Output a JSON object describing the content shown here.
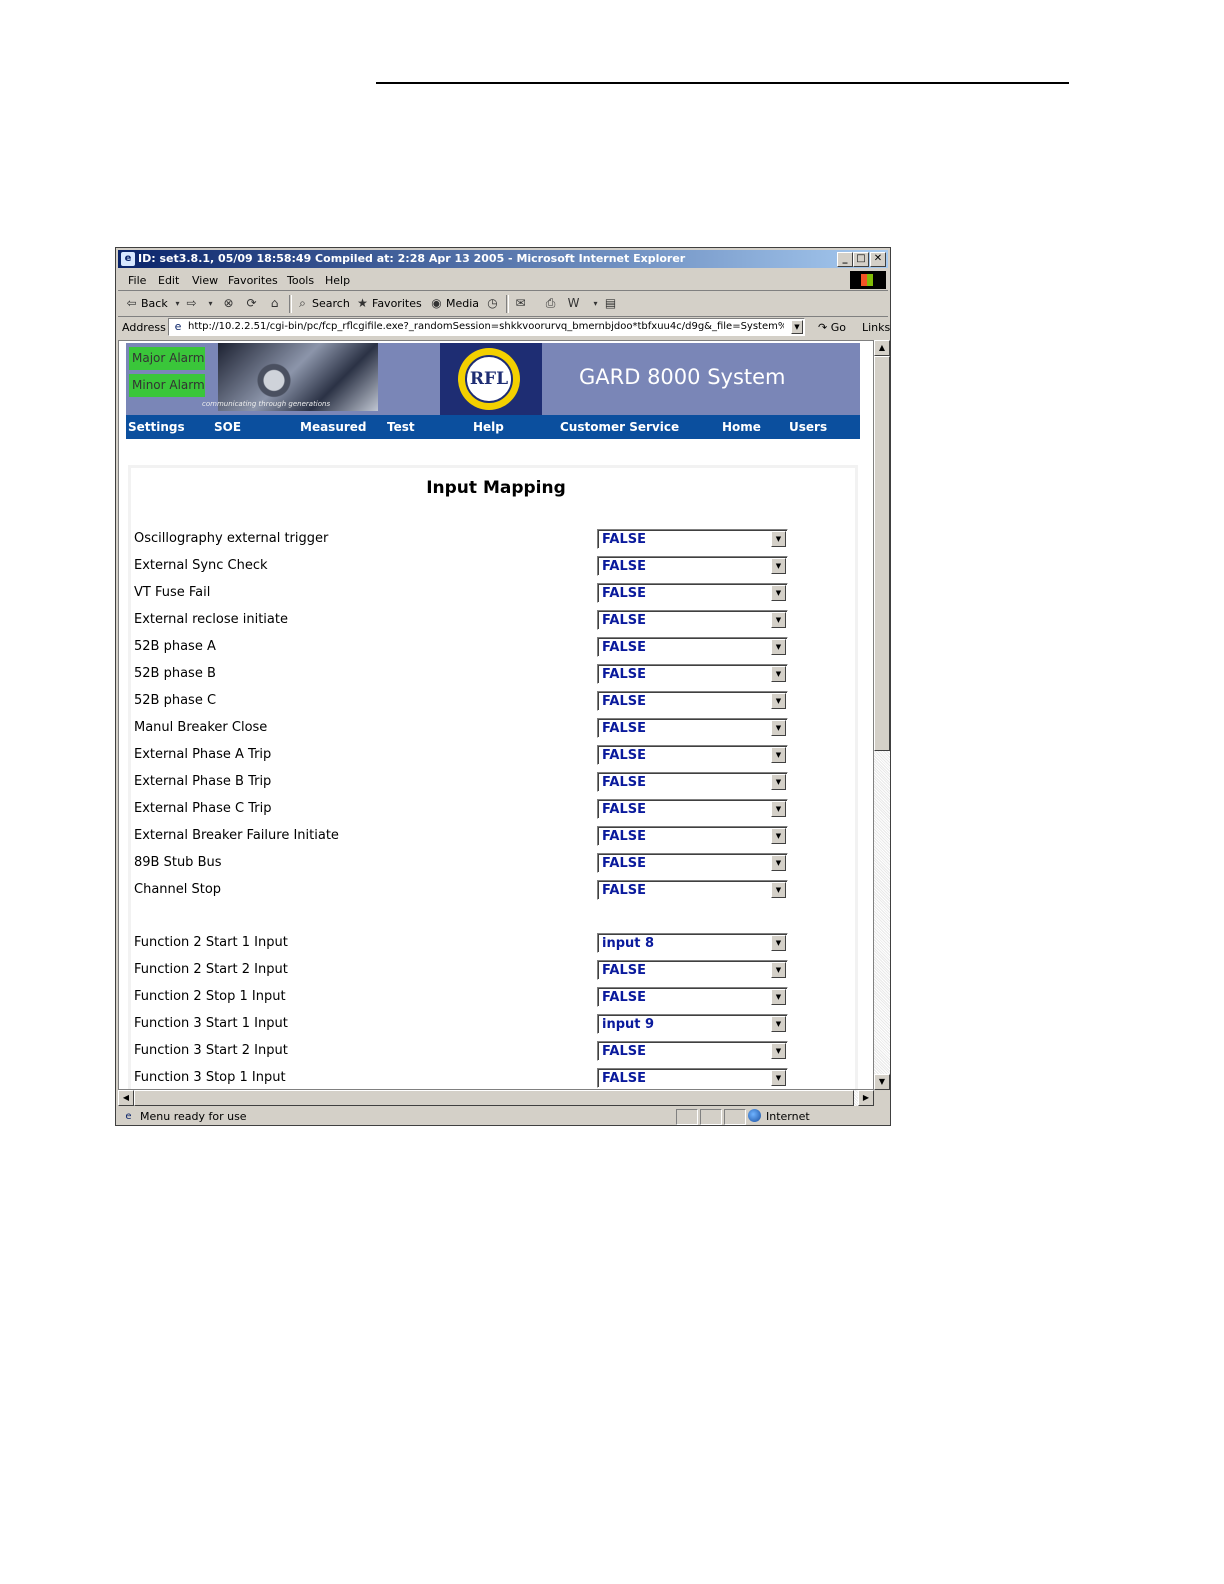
{
  "window": {
    "title": "ID: set3.8.1, 05/09 18:58:49 Compiled at: 2:28 Apr 13 2005 - Microsoft Internet Explorer",
    "minimize": "_",
    "maximize": "□",
    "close": "✕"
  },
  "menu": [
    "File",
    "Edit",
    "View",
    "Favorites",
    "Tools",
    "Help"
  ],
  "toolbar": {
    "back": "Back",
    "search": "Search",
    "favorites": "Favorites",
    "media": "Media"
  },
  "address": {
    "label": "Address",
    "url": "http://10.2.2.51/cgi-bin/pc/fcp_rflcgifile.exe?_randomSession=shkkvoorurvq_bmernbjdoo*tbfxuu4c/d9g&_file=System%20Logic%",
    "go": "Go",
    "links": "Links"
  },
  "banner": {
    "major_alarm": "Major Alarm",
    "minor_alarm": "Minor Alarm",
    "tagline": "communicating through generations",
    "logo_text": "RFL",
    "system_title": "GARD 8000 System"
  },
  "nav": [
    "Settings",
    "SOE",
    "Measured",
    "Test",
    "Help",
    "Customer Service",
    "Home",
    "Users"
  ],
  "page": {
    "heading": "Input Mapping",
    "rows": [
      {
        "label": "Oscillography external trigger",
        "value": "FALSE"
      },
      {
        "label": "External Sync Check",
        "value": "FALSE"
      },
      {
        "label": "VT Fuse Fail",
        "value": "FALSE"
      },
      {
        "label": "External reclose initiate",
        "value": "FALSE"
      },
      {
        "label": "52B phase A",
        "value": "FALSE"
      },
      {
        "label": "52B phase B",
        "value": "FALSE"
      },
      {
        "label": "52B phase C",
        "value": "FALSE"
      },
      {
        "label": "Manul Breaker Close",
        "value": "FALSE"
      },
      {
        "label": "External Phase A Trip",
        "value": "FALSE"
      },
      {
        "label": "External Phase B Trip",
        "value": "FALSE"
      },
      {
        "label": "External Phase C Trip",
        "value": "FALSE"
      },
      {
        "label": "External Breaker Failure Initiate",
        "value": "FALSE"
      },
      {
        "label": "89B Stub Bus",
        "value": "FALSE"
      },
      {
        "label": "Channel Stop",
        "value": "FALSE"
      },
      {
        "label": "Function 2 Start 1 Input",
        "value": "input 8"
      },
      {
        "label": "Function 2 Start 2 Input",
        "value": "FALSE"
      },
      {
        "label": "Function 2 Stop 1 Input",
        "value": "FALSE"
      },
      {
        "label": "Function 3 Start 1 Input",
        "value": "input 9"
      },
      {
        "label": "Function 3 Start 2 Input",
        "value": "FALSE"
      },
      {
        "label": "Function 3 Stop 1 Input",
        "value": "FALSE"
      }
    ]
  },
  "status": {
    "text": "Menu ready for use",
    "zone": "Internet"
  },
  "colors": {
    "banner": "#7a86b7",
    "navbar": "#0b4f9e",
    "alarm_green": "#3ac63a",
    "select_text": "#0a1a9c"
  }
}
